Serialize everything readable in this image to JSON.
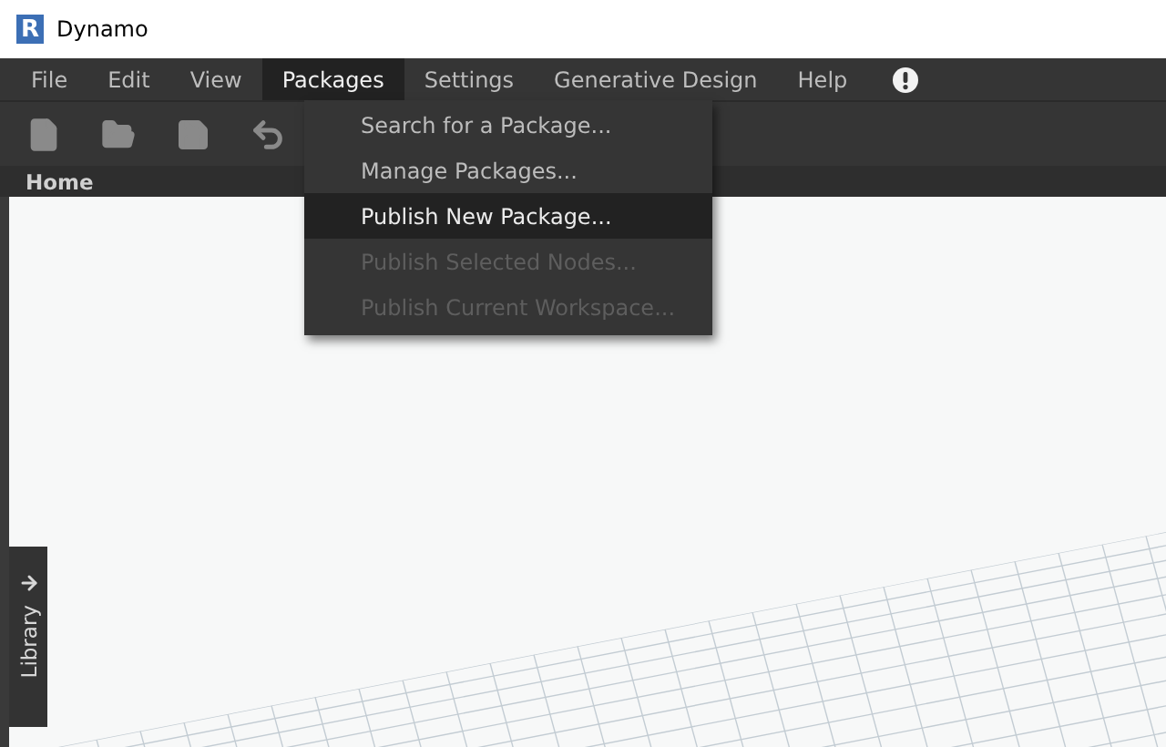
{
  "window": {
    "logo_letter": "R",
    "title": "Dynamo"
  },
  "menu": [
    {
      "label": "File",
      "selected": false
    },
    {
      "label": "Edit",
      "selected": false
    },
    {
      "label": "View",
      "selected": false
    },
    {
      "label": "Packages",
      "selected": true
    },
    {
      "label": "Settings",
      "selected": false
    },
    {
      "label": "Generative Design",
      "selected": false
    },
    {
      "label": "Help",
      "selected": false
    }
  ],
  "dropdown": [
    {
      "label": "Search for a Package...",
      "highlighted": false,
      "disabled": false
    },
    {
      "label": "Manage Packages...",
      "highlighted": false,
      "disabled": false
    },
    {
      "label": "Publish New Package...",
      "highlighted": true,
      "disabled": false
    },
    {
      "label": "Publish Selected Nodes...",
      "highlighted": false,
      "disabled": true
    },
    {
      "label": "Publish Current Workspace...",
      "highlighted": false,
      "disabled": true
    }
  ],
  "tabs": [
    {
      "label": "Home",
      "selected": true
    }
  ],
  "library": {
    "label": "Library"
  }
}
